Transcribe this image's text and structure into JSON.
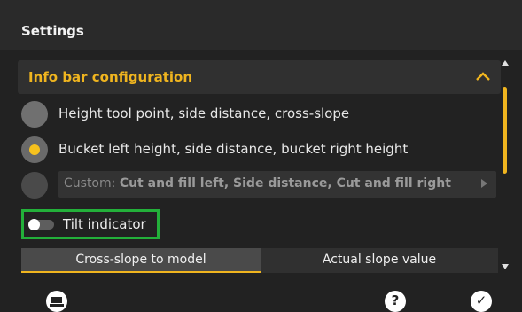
{
  "header": {
    "title": "Settings"
  },
  "section": {
    "title": "Info bar configuration",
    "collapse_icon": "chevron-up-icon",
    "accent": "#f0b51f"
  },
  "options": [
    {
      "label": "Height tool point, side distance, cross-slope",
      "selected": false
    },
    {
      "label": "Bucket left height, side distance, bucket right height",
      "selected": true
    }
  ],
  "custom": {
    "prefix": "Custom:",
    "value": "Cut and fill left, Side distance, Cut and fill right",
    "arrow_icon": "play-arrow-icon"
  },
  "tilt": {
    "label": "Tilt indicator",
    "enabled": false,
    "highlight_color": "#23b03a"
  },
  "slope_mode": {
    "options": [
      "Cross-slope to model",
      "Actual slope value"
    ],
    "selected": "Cross-slope to model"
  },
  "footer": {
    "left_icon": "machine-settings-icon",
    "help_icon": "help-icon",
    "help_glyph": "?",
    "confirm_icon": "checkmark-icon",
    "confirm_glyph": "✓"
  }
}
